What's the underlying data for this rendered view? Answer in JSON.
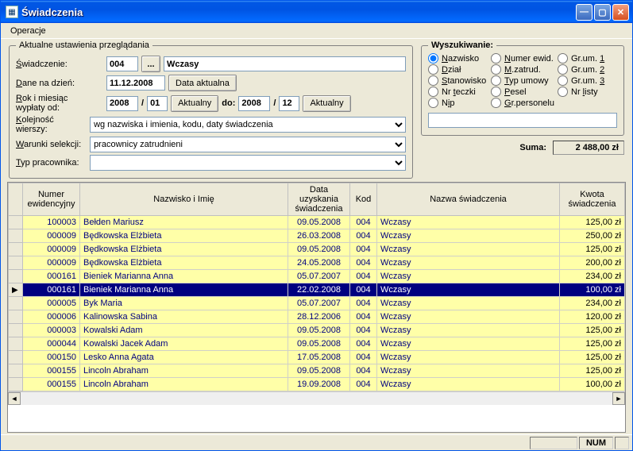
{
  "window": {
    "title": "Świadczenia"
  },
  "menu": {
    "operacje": "Operacje"
  },
  "settings": {
    "legend": "Aktualne ustawienia przeglądania",
    "swiadczenie_lbl": "Świadczenie:",
    "swiadczenie_code": "004",
    "swiadczenie_name": "Wczasy",
    "dane_lbl": "Dane na dzień:",
    "dane_val": "11.12.2008",
    "data_aktualna_btn": "Data aktualna",
    "rok_lbl": "Rok i miesiąc wypłaty od:",
    "rok1": "2008",
    "mies1": "01",
    "aktualny_btn": "Aktualny",
    "do_lbl": "do:",
    "rok2": "2008",
    "mies2": "12",
    "aktualny_btn2": "Aktualny",
    "kolejnosc_lbl": "Kolejność wierszy:",
    "kolejnosc_val": "wg nazwiska i imienia, kodu, daty świadczenia",
    "warunki_lbl": "Warunki selekcji:",
    "warunki_val": "pracownicy zatrudnieni",
    "typ_lbl": "Typ pracownika:",
    "typ_val": ""
  },
  "search": {
    "legend": "Wyszukiwanie:",
    "options": [
      {
        "label": "Nazwisko",
        "u": "N",
        "rest": "azwisko",
        "checked": true
      },
      {
        "label": "Numer ewid.",
        "u": "N",
        "rest": "umer ewid."
      },
      {
        "label": "Gr.um. 1",
        "u": "1",
        "pre": "Gr.um. "
      },
      {
        "label": "Dział",
        "u": "D",
        "rest": "ział"
      },
      {
        "label": "M.zatrud.",
        "u": "M",
        "rest": ".zatrud."
      },
      {
        "label": "Gr.um. 2",
        "u": "2",
        "pre": "Gr.um. "
      },
      {
        "label": "Stanowisko",
        "u": "S",
        "rest": "tanowisko"
      },
      {
        "label": "Typ umowy",
        "u": "T",
        "rest": "yp umowy"
      },
      {
        "label": "Gr.um. 3",
        "u": "3",
        "pre": "Gr.um. "
      },
      {
        "label": "Nr teczki",
        "u": "t",
        "pre": "Nr ",
        "rest": "eczki"
      },
      {
        "label": "Pesel",
        "u": "P",
        "rest": "esel"
      },
      {
        "label": "Nr listy",
        "u": "l",
        "pre": "Nr ",
        "rest": "isty"
      },
      {
        "label": "Nip",
        "u": "i",
        "pre": "N",
        "rest": "p"
      },
      {
        "label": "Gr.personelu",
        "u": "G",
        "rest": "r.personelu"
      }
    ],
    "input": ""
  },
  "suma": {
    "label": "Suma:",
    "value": "2 488,00 zł"
  },
  "columns": {
    "sel": "",
    "nr": "Numer ewidencyjny",
    "name": "Nazwisko i Imię",
    "date": "Data uzyskania świadczenia",
    "kod": "Kod",
    "nazwa": "Nazwa świadczenia",
    "kwota": "Kwota świadczenia"
  },
  "rows": [
    {
      "nr": "100003",
      "name": "Bełden Mariusz",
      "date": "09.05.2008",
      "kod": "004",
      "nazwa": "Wczasy",
      "kwota": "125,00 zł"
    },
    {
      "nr": "000009",
      "name": "Będkowska Elżbieta",
      "date": "26.03.2008",
      "kod": "004",
      "nazwa": "Wczasy",
      "kwota": "250,00 zł"
    },
    {
      "nr": "000009",
      "name": "Będkowska Elżbieta",
      "date": "09.05.2008",
      "kod": "004",
      "nazwa": "Wczasy",
      "kwota": "125,00 zł"
    },
    {
      "nr": "000009",
      "name": "Będkowska Elżbieta",
      "date": "24.05.2008",
      "kod": "004",
      "nazwa": "Wczasy",
      "kwota": "200,00 zł"
    },
    {
      "nr": "000161",
      "name": "Bieniek Marianna Anna",
      "date": "05.07.2007",
      "kod": "004",
      "nazwa": "Wczasy",
      "kwota": "234,00 zł"
    },
    {
      "nr": "000161",
      "name": "Bieniek Marianna Anna",
      "date": "22.02.2008",
      "kod": "004",
      "nazwa": "Wczasy",
      "kwota": "100,00 zł",
      "selected": true
    },
    {
      "nr": "000005",
      "name": "Byk Maria",
      "date": "05.07.2007",
      "kod": "004",
      "nazwa": "Wczasy",
      "kwota": "234,00 zł"
    },
    {
      "nr": "000006",
      "name": "Kalinowska Sabina",
      "date": "28.12.2006",
      "kod": "004",
      "nazwa": "Wczasy",
      "kwota": "120,00 zł"
    },
    {
      "nr": "000003",
      "name": "Kowalski Adam",
      "date": "09.05.2008",
      "kod": "004",
      "nazwa": "Wczasy",
      "kwota": "125,00 zł"
    },
    {
      "nr": "000044",
      "name": "Kowalski Jacek Adam",
      "date": "09.05.2008",
      "kod": "004",
      "nazwa": "Wczasy",
      "kwota": "125,00 zł"
    },
    {
      "nr": "000150",
      "name": "Lesko Anna Agata",
      "date": "17.05.2008",
      "kod": "004",
      "nazwa": "Wczasy",
      "kwota": "125,00 zł"
    },
    {
      "nr": "000155",
      "name": "Lincoln Abraham",
      "date": "09.05.2008",
      "kod": "004",
      "nazwa": "Wczasy",
      "kwota": "125,00 zł"
    },
    {
      "nr": "000155",
      "name": "Lincoln Abraham",
      "date": "19.09.2008",
      "kod": "004",
      "nazwa": "Wczasy",
      "kwota": "100,00 zł"
    }
  ],
  "status": {
    "num": "NUM"
  }
}
